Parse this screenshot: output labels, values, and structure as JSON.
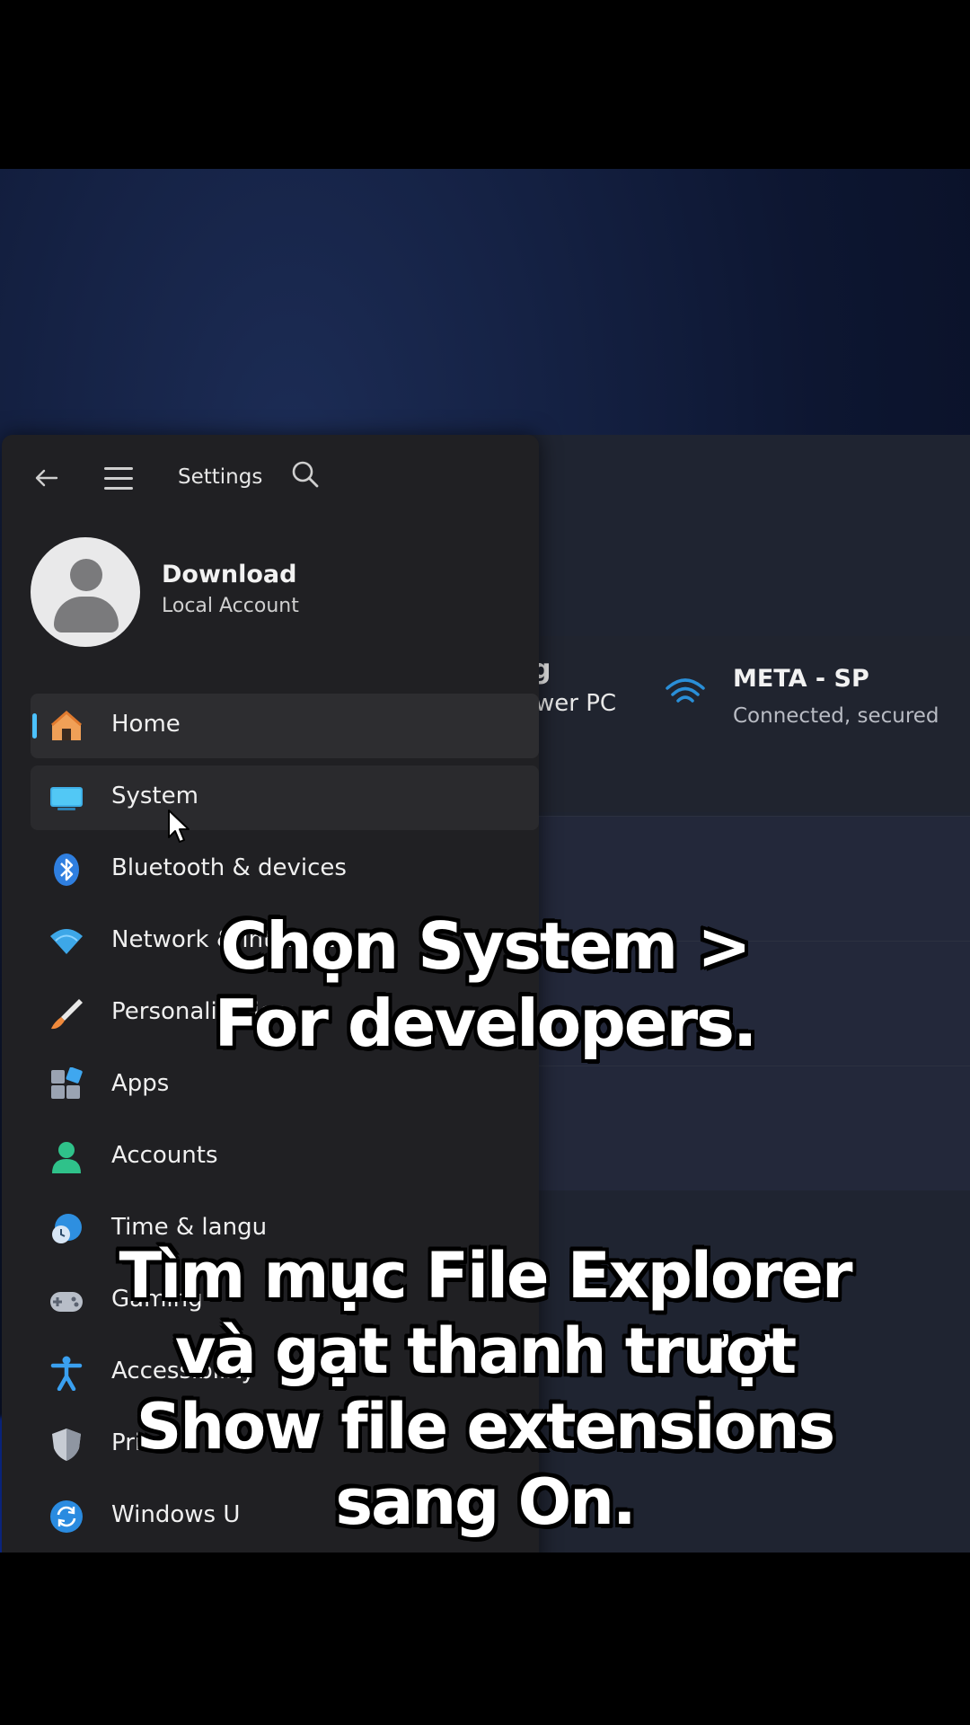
{
  "settings": {
    "title": "Settings",
    "profile": {
      "name": "Download",
      "account_type": "Local Account"
    },
    "nav": [
      {
        "label": "Home",
        "icon": "home-icon",
        "state": "active"
      },
      {
        "label": "System",
        "icon": "system-icon",
        "state": "hover"
      },
      {
        "label": "Bluetooth & devices",
        "icon": "bluetooth-icon"
      },
      {
        "label": "Network & internet",
        "icon": "wifi-icon"
      },
      {
        "label": "Personalization",
        "icon": "brush-icon"
      },
      {
        "label": "Apps",
        "icon": "apps-icon"
      },
      {
        "label": "Accounts",
        "icon": "person-icon"
      },
      {
        "label": "Time & langu",
        "icon": "clock-globe-icon"
      },
      {
        "label": "Gaming",
        "icon": "gamepad-icon"
      },
      {
        "label": "Accessibility",
        "icon": "accessibility-icon"
      },
      {
        "label": "Priva",
        "icon": "shield-icon"
      },
      {
        "label": "Windows U",
        "icon": "windows-update-icon"
      }
    ]
  },
  "home_pane": {
    "pc_fragment_top": "g",
    "pc_fragment": "wer PC",
    "network_name": "META - SP",
    "network_status": "Connected, secured"
  },
  "captions": {
    "caption1": [
      "Chọn System >",
      "For developers."
    ],
    "caption2": [
      "Tìm mục File Explorer",
      "và gạt thanh trượt",
      "Show file extensions",
      "sang On."
    ]
  },
  "colors": {
    "accent": "#4cc2ff",
    "panel_bg": "#202023",
    "screen_bg": "#0d1631"
  }
}
